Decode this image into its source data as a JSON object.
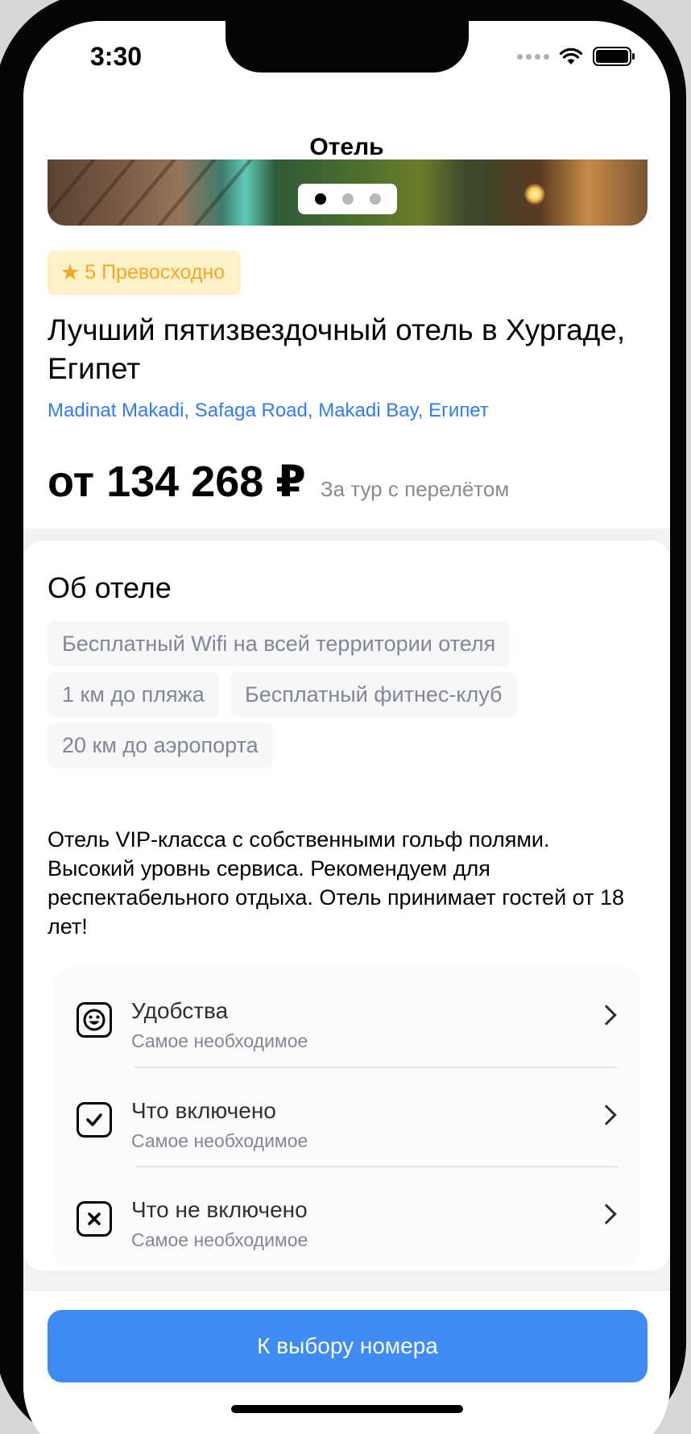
{
  "status_bar": {
    "time": "3:30"
  },
  "header": {
    "title": "Отель"
  },
  "gallery": {
    "page_count": 3,
    "active_index": 0
  },
  "hotel": {
    "rating_label": "5 Превосходно",
    "name": "Лучший пятизвездочный отель в Хургаде, Египет",
    "address": "Madinat Makadi, Safaga Road, Makadi Bay, Египет",
    "price": "от 134 268 ₽",
    "price_note": "За тур с перелётом"
  },
  "about": {
    "title": "Об отеле",
    "peculiarities": [
      "Бесплатный Wifi на всей территории отеля",
      "1 км до пляжа",
      "Бесплатный фитнес-клуб",
      "20 км до аэропорта"
    ],
    "description": "Отель VIP-класса с собственными гольф полями. Высокий уровнь сервиса. Рекомендуем для респектабельного отдыха. Отель принимает гостей от 18 лет!",
    "features": [
      {
        "title": "Удобства",
        "subtitle": "Самое необходимое",
        "icon": "emoji-smile-icon"
      },
      {
        "title": "Что включено",
        "subtitle": "Самое необходимое",
        "icon": "square-check-icon"
      },
      {
        "title": "Что не включено",
        "subtitle": "Самое необходимое",
        "icon": "square-x-icon"
      }
    ]
  },
  "footer": {
    "button_label": "К выбору номера"
  },
  "colors": {
    "accent": "#3d8bf3",
    "rating_bg": "#fff1c7",
    "rating_text": "#f5a623",
    "address": "#2f7df0",
    "muted_text": "#828796"
  }
}
